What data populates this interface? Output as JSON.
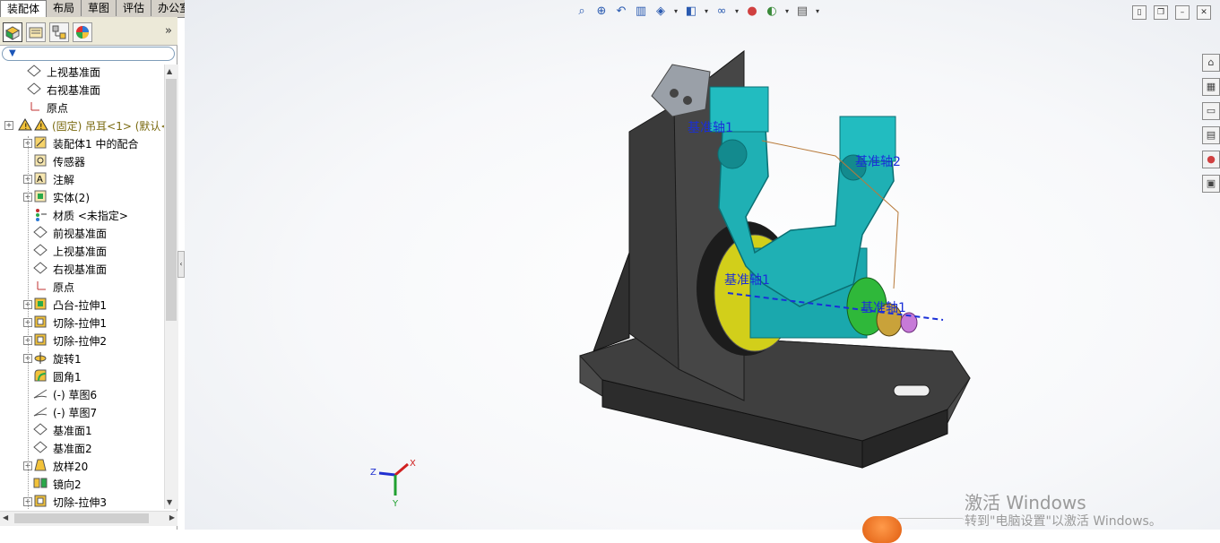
{
  "tabs": [
    "装配体",
    "布局",
    "草图",
    "评估",
    "办公室产品"
  ],
  "panel": {
    "tab_icons": [
      "feature-manager-icon",
      "property-manager-icon",
      "configuration-manager-icon",
      "display-manager-icon"
    ],
    "collapse_glyph": "»",
    "tree": [
      {
        "label": "上视基准面",
        "icon": "plane-icon",
        "indent": 1,
        "expand": false
      },
      {
        "label": "右视基准面",
        "icon": "plane-icon",
        "indent": 1,
        "expand": false
      },
      {
        "label": "原点",
        "icon": "origin-icon",
        "indent": 1,
        "expand": false
      },
      {
        "label": "(固定) 吊耳<1> (默认<",
        "icon": "part-warning-icon",
        "indent": 0,
        "expand": true,
        "warning": true
      },
      {
        "label": "装配体1 中的配合",
        "icon": "mates-icon",
        "indent": 2,
        "expand": true
      },
      {
        "label": "传感器",
        "icon": "sensor-icon",
        "indent": 2,
        "expand": false
      },
      {
        "label": "注解",
        "icon": "annotation-icon",
        "indent": 2,
        "expand": true
      },
      {
        "label": "实体(2)",
        "icon": "solid-bodies-icon",
        "indent": 2,
        "expand": true
      },
      {
        "label": "材质 <未指定>",
        "icon": "material-icon",
        "indent": 2,
        "expand": false
      },
      {
        "label": "前视基准面",
        "icon": "plane-icon",
        "indent": 2,
        "expand": false
      },
      {
        "label": "上视基准面",
        "icon": "plane-icon",
        "indent": 2,
        "expand": false
      },
      {
        "label": "右视基准面",
        "icon": "plane-icon",
        "indent": 2,
        "expand": false
      },
      {
        "label": "原点",
        "icon": "origin-icon",
        "indent": 2,
        "expand": false
      },
      {
        "label": "凸台-拉伸1",
        "icon": "boss-extrude-icon",
        "indent": 2,
        "expand": true
      },
      {
        "label": "切除-拉伸1",
        "icon": "cut-extrude-icon",
        "indent": 2,
        "expand": true
      },
      {
        "label": "切除-拉伸2",
        "icon": "cut-extrude-icon",
        "indent": 2,
        "expand": true
      },
      {
        "label": "旋转1",
        "icon": "revolve-icon",
        "indent": 2,
        "expand": true
      },
      {
        "label": "圆角1",
        "icon": "fillet-icon",
        "indent": 2,
        "expand": false
      },
      {
        "label": "(-) 草图6",
        "icon": "sketch-icon",
        "indent": 2,
        "expand": false
      },
      {
        "label": "(-) 草图7",
        "icon": "sketch-icon",
        "indent": 2,
        "expand": false
      },
      {
        "label": "基准面1",
        "icon": "plane-icon",
        "indent": 2,
        "expand": false
      },
      {
        "label": "基准面2",
        "icon": "plane-icon",
        "indent": 2,
        "expand": false
      },
      {
        "label": "放样20",
        "icon": "loft-icon",
        "indent": 2,
        "expand": true
      },
      {
        "label": "镜向2",
        "icon": "mirror-icon",
        "indent": 2,
        "expand": false
      },
      {
        "label": "切除-拉伸3",
        "icon": "cut-extrude-icon",
        "indent": 2,
        "expand": true
      }
    ]
  },
  "headsup_icons": [
    "zoom-to-fit-icon",
    "zoom-to-area-icon",
    "previous-view-icon",
    "section-view-icon",
    "view-orientation-icon",
    "display-style-icon",
    "hide-show-items-icon",
    "edit-appearance-icon",
    "apply-scene-icon",
    "view-settings-icon"
  ],
  "window_buttons": [
    "tile-icon",
    "restore-icon",
    "minimize-icon",
    "close-icon"
  ],
  "taskpane_icons": [
    "solidworks-resources-icon",
    "design-library-icon",
    "file-explorer-icon",
    "view-palette-icon",
    "appearances-icon",
    "custom-properties-icon"
  ],
  "model": {
    "axis_labels": [
      "基准轴1",
      "基准轴2",
      "基准轴1",
      "基准轴1"
    ]
  },
  "triad": {
    "x": "X",
    "y": "Y",
    "z": "Z"
  },
  "watermark": {
    "line1": "激活 Windows",
    "line2": "转到\"电脑设置\"以激活 Windows。"
  },
  "colors": {
    "teal": "#1fb0b4",
    "dark_base": "#3a3a3a",
    "yellow_bushing": "#d6d41a",
    "green_ring": "#2fb83a",
    "axis_blue": "#1a2fd8"
  }
}
